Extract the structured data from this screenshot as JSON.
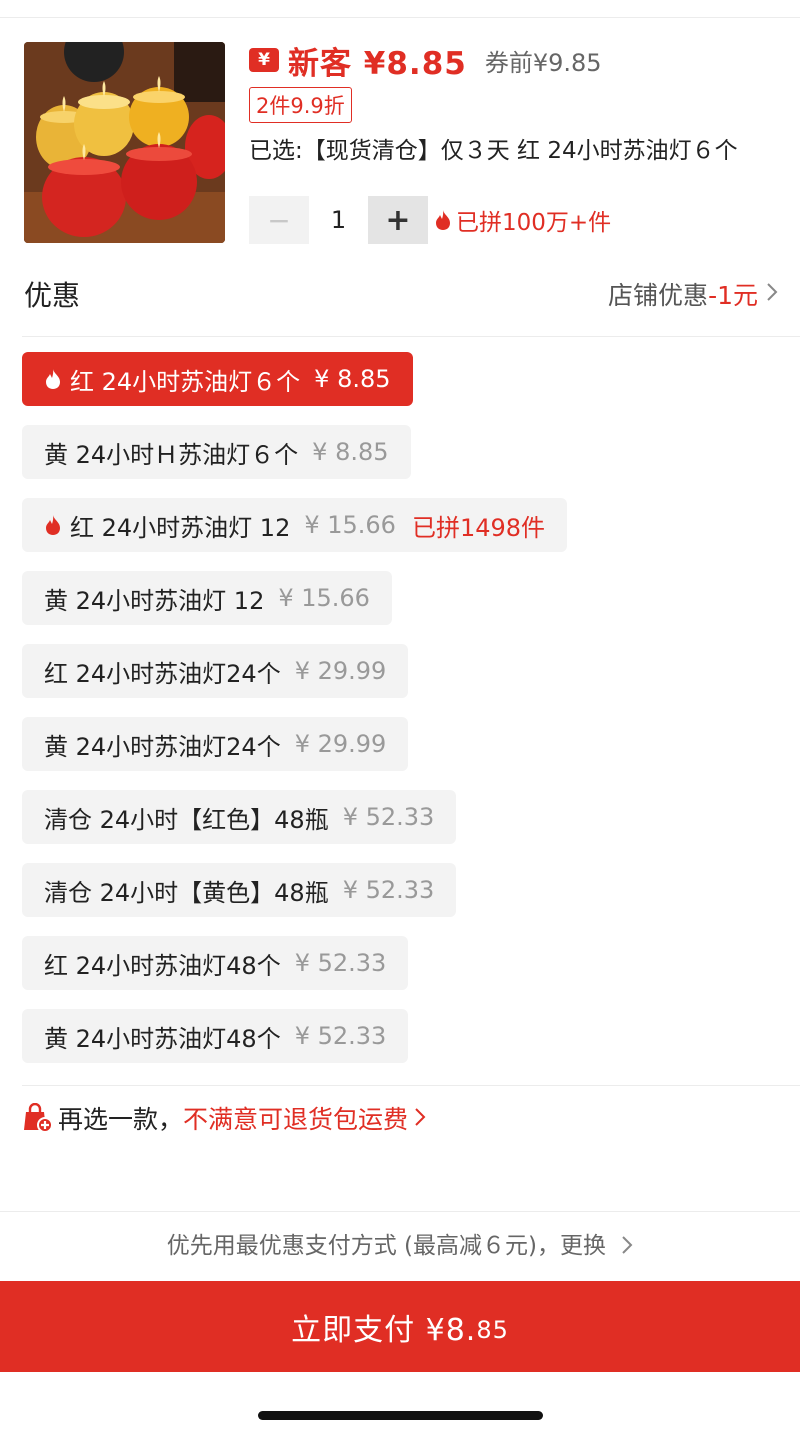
{
  "product": {
    "image_alt": "red and yellow butter lamp candles",
    "price_prefix": "新客",
    "price": "¥8.85",
    "price_before": "券前¥9.85",
    "discount_tag": "2件9.9折",
    "selected_label": "已选:【现货清仓】仅３天 红 24小时苏油灯６个",
    "quantity": "1",
    "sold_count": "已拼100万+件"
  },
  "promo": {
    "title": "优惠",
    "store_label": "店铺优惠",
    "store_value": "-1元"
  },
  "skus": [
    {
      "label": "红 24小时苏油灯６个",
      "price": "¥ 8.85",
      "hot": "",
      "selected": true,
      "flame": true
    },
    {
      "label": "黄 24小时Ｈ苏油灯６个",
      "price": "¥ 8.85",
      "hot": "",
      "selected": false,
      "flame": false
    },
    {
      "label": "红 24小时苏油灯 12",
      "price": "¥ 15.66",
      "hot": "已拼1498件",
      "selected": false,
      "flame": true
    },
    {
      "label": "黄 24小时苏油灯 12",
      "price": "¥ 15.66",
      "hot": "",
      "selected": false,
      "flame": false
    },
    {
      "label": "红 24小时苏油灯24个",
      "price": "¥ 29.99",
      "hot": "",
      "selected": false,
      "flame": false
    },
    {
      "label": "黄 24小时苏油灯24个",
      "price": "¥ 29.99",
      "hot": "",
      "selected": false,
      "flame": false
    },
    {
      "label": "清仓 24小时【红色】48瓶",
      "price": "¥ 52.33",
      "hot": "",
      "selected": false,
      "flame": false
    },
    {
      "label": "清仓 24小时【黄色】48瓶",
      "price": "¥ 52.33",
      "hot": "",
      "selected": false,
      "flame": false
    },
    {
      "label": "红 24小时苏油灯48个",
      "price": "¥ 52.33",
      "hot": "",
      "selected": false,
      "flame": false
    },
    {
      "label": "黄 24小时苏油灯48个",
      "price": "¥ 52.33",
      "hot": "",
      "selected": false,
      "flame": false
    }
  ],
  "return_policy": {
    "prefix": "再选一款，",
    "link": "不满意可退货包运费"
  },
  "payment": {
    "method_text": "优先用最优惠支付方式 (最高减６元)，更换",
    "button_label": "立即支付 ¥8.",
    "button_cents": "85"
  },
  "icons": {
    "yen": "yen-badge-icon",
    "flame": "flame-icon",
    "bag": "shopping-bag-plus-icon",
    "chevron": "chevron-right-icon"
  },
  "colors": {
    "accent": "#e02e24",
    "chip_bg": "#f3f3f3",
    "muted": "#999999"
  }
}
